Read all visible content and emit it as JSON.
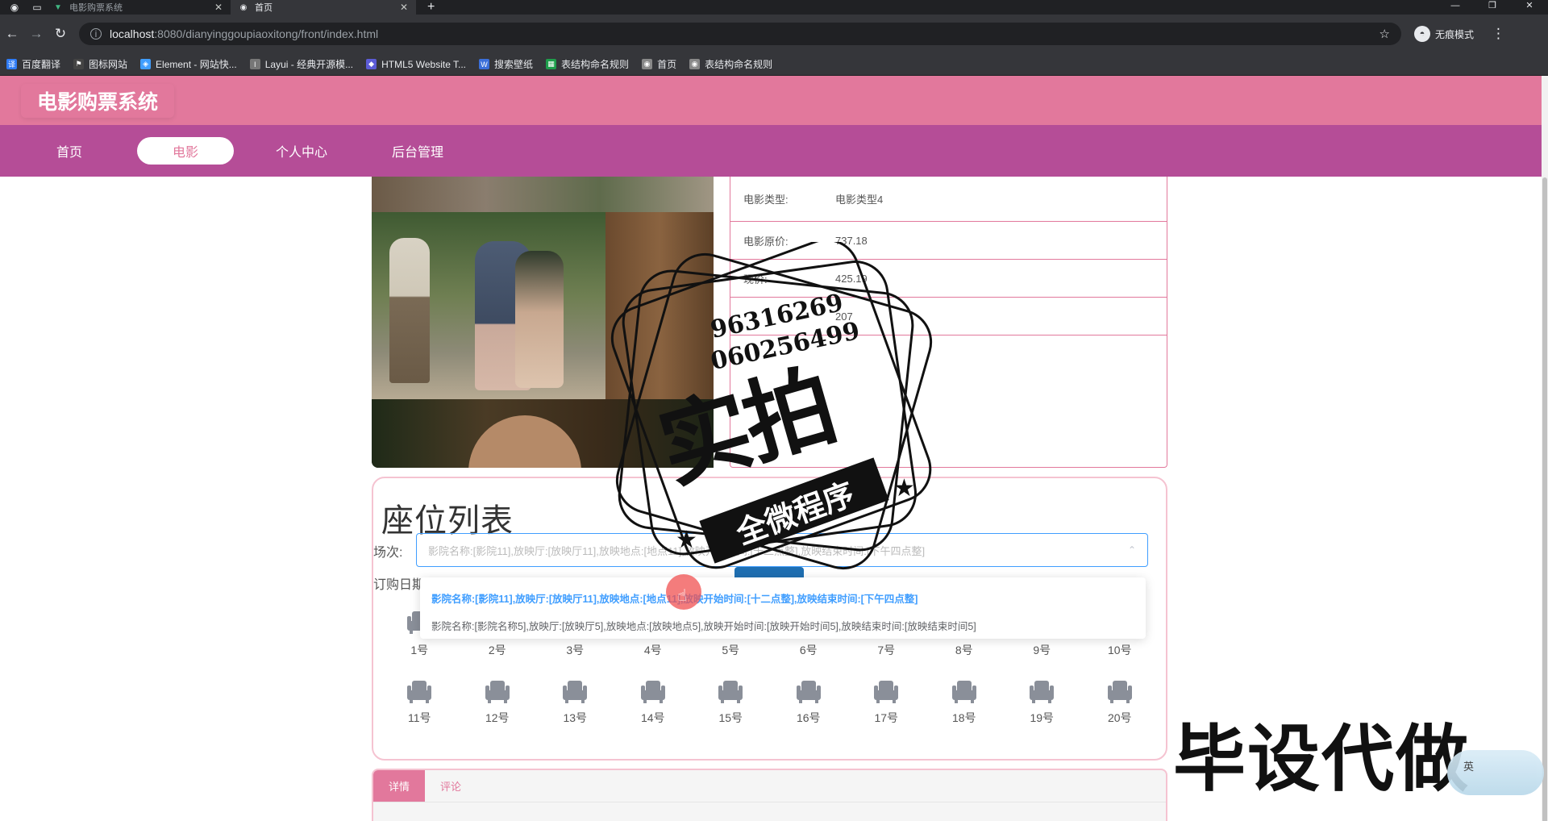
{
  "browser": {
    "tabs": [
      {
        "title": "电影购票系统",
        "active": false
      },
      {
        "title": "首页",
        "active": true
      }
    ],
    "url_host": "localhost",
    "url_path": ":8080/dianyinggoupiaoxitong/front/index.html",
    "profile_label": "无痕模式",
    "window_controls": [
      "—",
      "❐",
      "✕"
    ],
    "bookmarks": [
      {
        "label": "百度翻译",
        "icon": "translate-icon",
        "color": "#2f7cf6"
      },
      {
        "label": "图标网站",
        "icon": "flag-icon",
        "color": "#444444"
      },
      {
        "label": "Element - 网站快...",
        "icon": "element-icon",
        "color": "#409eff"
      },
      {
        "label": "Layui - 经典开源模...",
        "icon": "layui-icon",
        "color": "#777777"
      },
      {
        "label": "HTML5 Website T...",
        "icon": "html5-icon",
        "color": "#5c5cd6"
      },
      {
        "label": "搜索壁纸",
        "icon": "wallpaper-icon",
        "color": "#3b6fd9"
      },
      {
        "label": "表结构命名规则",
        "icon": "sheet-icon",
        "color": "#1e9e4b"
      },
      {
        "label": "首页",
        "icon": "globe-icon",
        "color": "#888888"
      },
      {
        "label": "表结构命名规则",
        "icon": "globe-icon",
        "color": "#888888"
      }
    ]
  },
  "site": {
    "title": "电影购票系统",
    "nav": [
      {
        "label": "首页",
        "active": false
      },
      {
        "label": "电影",
        "active": true
      },
      {
        "label": "个人中心",
        "active": false
      },
      {
        "label": "后台管理",
        "active": false
      }
    ],
    "colors": {
      "header": "#e2789c",
      "navbar": "#b54d97",
      "accent": "#409eff"
    }
  },
  "movie": {
    "fields": [
      {
        "label": "电影类型:",
        "value": "电影类型4"
      },
      {
        "label": "电影原价:",
        "value": "737.18"
      },
      {
        "label": "现价:",
        "value": "425.19"
      },
      {
        "label": "",
        "value": "207"
      }
    ]
  },
  "seats": {
    "heading": "座位列表",
    "session_label": "场次:",
    "session_placeholder": "影院名称:[影院11],放映厅:[放映厅11],放映地点:[地点11],放映开始时间:[十二点整],放映结束时间:[下午四点整]",
    "order_date_label": "订购日期",
    "options": [
      {
        "text": "影院名称:[影院11],放映厅:[放映厅11],放映地点:[地点11],放映开始时间:[十二点整],放映结束时间:[下午四点整]",
        "selected": true
      },
      {
        "text": "影院名称:[影院名称5],放映厅:[放映厅5],放映地点:[放映地点5],放映开始时间:[放映开始时间5],放映结束时间:[放映结束时间5]",
        "selected": false
      }
    ],
    "rows": [
      [
        "1号",
        "2号",
        "3号",
        "4号",
        "5号",
        "6号",
        "7号",
        "8号",
        "9号",
        "10号"
      ],
      [
        "11号",
        "12号",
        "13号",
        "14号",
        "15号",
        "16号",
        "17号",
        "18号",
        "19号",
        "20号"
      ]
    ]
  },
  "tabs": [
    {
      "label": "详情",
      "active": true
    },
    {
      "label": "评论",
      "active": false
    }
  ],
  "watermark": {
    "numbers": [
      "9631626​9",
      "0602564​99"
    ],
    "big_text": "实拍",
    "ribbon_text": "全微程序",
    "corner_text": "毕设代做",
    "ime_text": "英"
  }
}
